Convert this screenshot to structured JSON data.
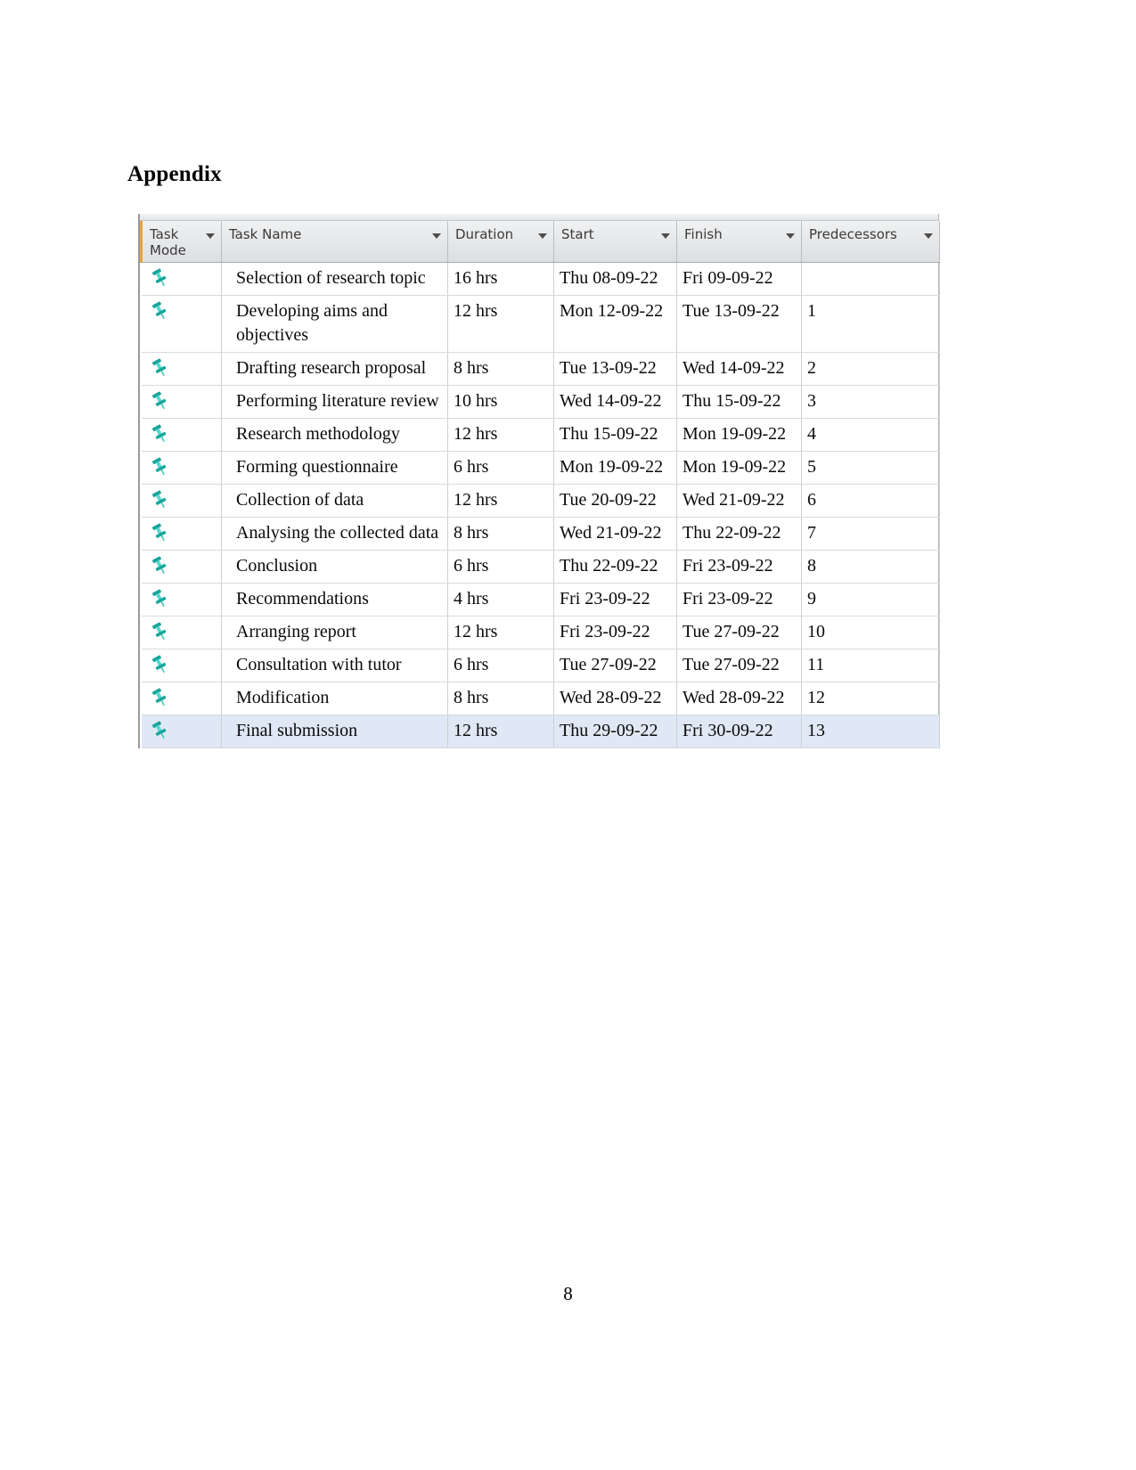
{
  "document": {
    "heading": "Appendix",
    "page_number": "8"
  },
  "grid": {
    "columns": [
      {
        "key": "task_mode",
        "label": "Task\nMode",
        "has_filter_arrow": true
      },
      {
        "key": "task_name",
        "label": "Task Name",
        "has_filter_arrow": true
      },
      {
        "key": "duration",
        "label": "Duration",
        "has_filter_arrow": true
      },
      {
        "key": "start",
        "label": "Start",
        "has_filter_arrow": true
      },
      {
        "key": "finish",
        "label": "Finish",
        "has_filter_arrow": true
      },
      {
        "key": "predecessors",
        "label": "Predecessors",
        "has_filter_arrow": true
      }
    ],
    "rows": [
      {
        "mode_icon": "pin-icon",
        "task_name": "Selection of research topic",
        "duration": "16 hrs",
        "start": "Thu 08-09-22",
        "finish": "Fri 09-09-22",
        "predecessors": "",
        "selected": false
      },
      {
        "mode_icon": "pin-icon",
        "task_name": "Developing aims and objectives",
        "duration": "12 hrs",
        "start": "Mon 12-09-22",
        "finish": "Tue 13-09-22",
        "predecessors": "1",
        "selected": false
      },
      {
        "mode_icon": "pin-icon",
        "task_name": "Drafting research proposal",
        "duration": "8 hrs",
        "start": "Tue 13-09-22",
        "finish": "Wed 14-09-22",
        "predecessors": "2",
        "selected": false
      },
      {
        "mode_icon": "pin-icon",
        "task_name": "Performing literature review",
        "duration": "10 hrs",
        "start": "Wed 14-09-22",
        "finish": "Thu 15-09-22",
        "predecessors": "3",
        "selected": false
      },
      {
        "mode_icon": "pin-icon",
        "task_name": "Research methodology",
        "duration": "12 hrs",
        "start": "Thu 15-09-22",
        "finish": "Mon 19-09-22",
        "predecessors": "4",
        "selected": false
      },
      {
        "mode_icon": "pin-icon",
        "task_name": "Forming questionnaire",
        "duration": "6 hrs",
        "start": "Mon 19-09-22",
        "finish": "Mon 19-09-22",
        "predecessors": "5",
        "selected": false
      },
      {
        "mode_icon": "pin-icon",
        "task_name": "Collection of data",
        "duration": "12 hrs",
        "start": "Tue 20-09-22",
        "finish": "Wed 21-09-22",
        "predecessors": "6",
        "selected": false
      },
      {
        "mode_icon": "pin-icon",
        "task_name": "Analysing the collected data",
        "duration": "8 hrs",
        "start": "Wed 21-09-22",
        "finish": "Thu 22-09-22",
        "predecessors": "7",
        "selected": false
      },
      {
        "mode_icon": "pin-icon",
        "task_name": "Conclusion",
        "duration": "6 hrs",
        "start": "Thu 22-09-22",
        "finish": "Fri 23-09-22",
        "predecessors": "8",
        "selected": false
      },
      {
        "mode_icon": "pin-icon",
        "task_name": "Recommendations",
        "duration": "4 hrs",
        "start": "Fri 23-09-22",
        "finish": "Fri 23-09-22",
        "predecessors": "9",
        "selected": false
      },
      {
        "mode_icon": "pin-icon",
        "task_name": "Arranging report",
        "duration": "12 hrs",
        "start": "Fri 23-09-22",
        "finish": "Tue 27-09-22",
        "predecessors": "10",
        "selected": false
      },
      {
        "mode_icon": "pin-icon",
        "task_name": "Consultation with tutor",
        "duration": "6 hrs",
        "start": "Tue 27-09-22",
        "finish": "Tue 27-09-22",
        "predecessors": "11",
        "selected": false
      },
      {
        "mode_icon": "pin-icon",
        "task_name": "Modification",
        "duration": "8 hrs",
        "start": "Wed 28-09-22",
        "finish": "Wed 28-09-22",
        "predecessors": "12",
        "selected": false
      },
      {
        "mode_icon": "pin-icon",
        "task_name": "Final submission",
        "duration": "12 hrs",
        "start": "Thu 29-09-22",
        "finish": "Fri 30-09-22",
        "predecessors": "13",
        "selected": true
      }
    ],
    "colors": {
      "header_gradient_top": "#f0f1f2",
      "header_gradient_bottom": "#dcdee1",
      "header_accent": "#e8a33d",
      "grid_line": "#ccd0d4",
      "selection": "#dfe8f4",
      "pin_icon": "#2fb6ad"
    }
  }
}
